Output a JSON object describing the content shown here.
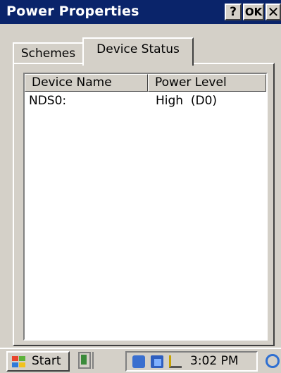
{
  "window": {
    "title": "Power Properties",
    "help_label": "?",
    "ok_label": "OK",
    "close_label": "✕"
  },
  "tabs": [
    {
      "label": "Schemes",
      "selected": false
    },
    {
      "label": "Device Status",
      "selected": true
    }
  ],
  "device_list": {
    "columns": [
      "Device Name",
      "Power Level"
    ],
    "rows": [
      {
        "device_name": "NDS0:",
        "power_level": "High  (D0)"
      }
    ]
  },
  "taskbar": {
    "start_label": "Start",
    "clock": "3:02 PM",
    "tray_icons": [
      "network-icon",
      "connection-icon",
      "power-plug-icon"
    ],
    "quick_launch_icons": [
      "desktop-icon",
      "app-icon"
    ],
    "ie_icon": "internet-explorer-icon"
  },
  "colors": {
    "titlebar": "#0a246a",
    "face": "#d4d0c8",
    "list_background": "#ffffff"
  }
}
